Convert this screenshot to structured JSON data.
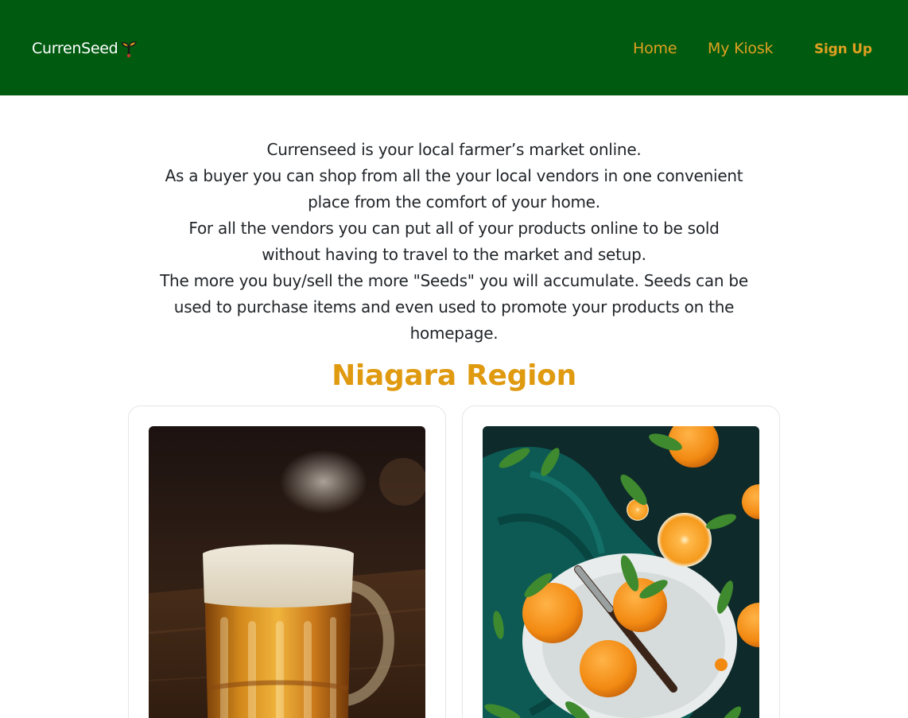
{
  "navbar": {
    "brand": "CurrenSeed",
    "brand_icon": "sprout-icon",
    "links": [
      {
        "label": "Home"
      },
      {
        "label": "My Kiosk"
      },
      {
        "label": "Sign Up"
      }
    ],
    "colors": {
      "background": "#005a10",
      "link": "#e0a020",
      "brand": "#ffffff"
    }
  },
  "intro": {
    "lines": [
      "Currenseed is your local farmer’s market online.",
      "As a buyer you can shop from all the your local vendors in one convenient place from the comfort of your home.",
      "For all the vendors you can put all of your products online to be sold without having to travel to the market and setup.",
      "The more you buy/sell the more \"Seeds\" you will accumulate. Seeds can be used to purchase items and even used to promote your products on the homepage."
    ]
  },
  "region": {
    "title": "Niagara Region",
    "color": "#e09a10",
    "cards": [
      {
        "image": "beer-mug-photo"
      },
      {
        "image": "mandarin-oranges-photo"
      }
    ]
  }
}
